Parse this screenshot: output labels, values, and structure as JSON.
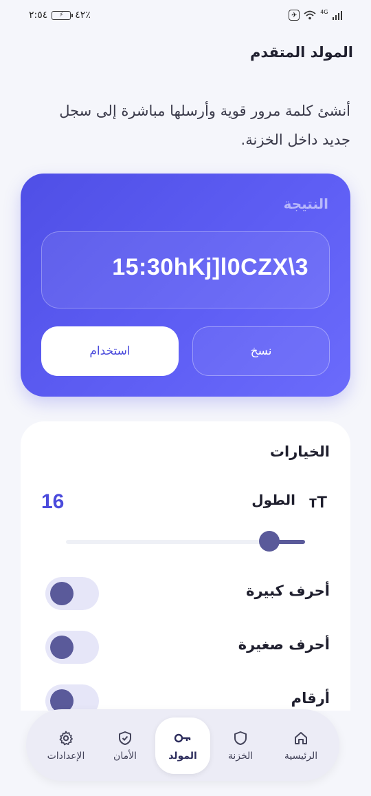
{
  "status_bar": {
    "time": "٢:٥٤",
    "battery": "٤٢٪",
    "network": "4G"
  },
  "header": {
    "title": "المولد المتقدم",
    "subtitle": "أنشئ كلمة مرور قوية وأرسلها مباشرة إلى سجل جديد داخل الخزنة."
  },
  "result": {
    "label": "النتيجة",
    "password": "15:30hKj]l0CZX\\3",
    "copy_label": "نسخ",
    "use_label": "استخدام"
  },
  "options": {
    "title": "الخيارات",
    "length_icon": "text-size-icon",
    "length_label": "الطول",
    "length_value": "16",
    "slider_fraction": 0.15,
    "toggles": [
      {
        "label": "أحرف كبيرة",
        "on": false
      },
      {
        "label": "أحرف صغيرة",
        "on": false
      },
      {
        "label": "أرقام",
        "on": false
      }
    ]
  },
  "nav": {
    "items": [
      {
        "label": "الرئيسية",
        "icon": "home-icon"
      },
      {
        "label": "الخزنة",
        "icon": "shield-icon"
      },
      {
        "label": "المولد",
        "icon": "key-icon",
        "active": true
      },
      {
        "label": "الأمان",
        "icon": "shield-check-icon"
      },
      {
        "label": "الإعدادات",
        "icon": "gear-icon"
      }
    ]
  },
  "colors": {
    "accent": "#4b4bdc",
    "card_gradient_start": "#4f4fe6",
    "card_gradient_end": "#6b6bfb",
    "toggle_knob": "#5a5a9a",
    "toggle_track": "#e6e6f8"
  }
}
